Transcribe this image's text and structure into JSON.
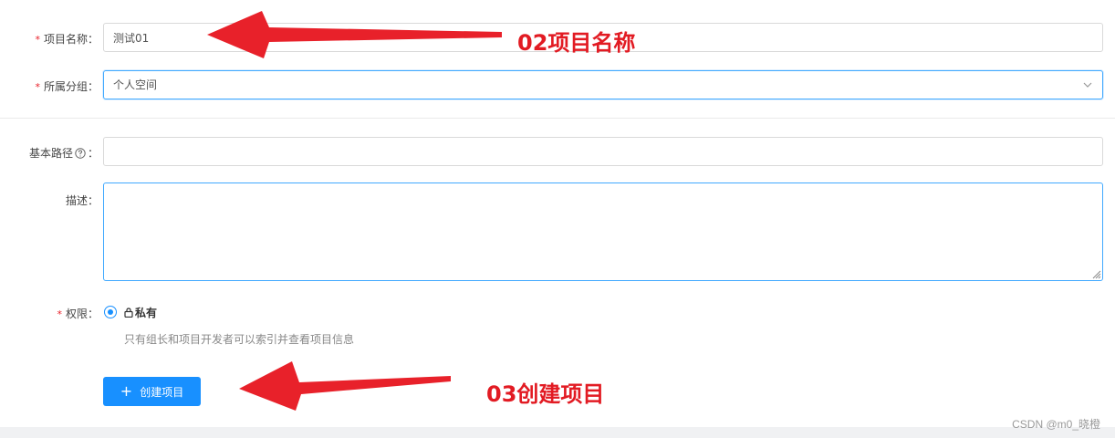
{
  "form": {
    "project_name": {
      "label": "项目名称",
      "value": "测试01"
    },
    "group": {
      "label": "所属分组",
      "value": "个人空间"
    },
    "base_path": {
      "label": "基本路径",
      "value": ""
    },
    "description": {
      "label": "描述",
      "value": ""
    },
    "permission": {
      "label": "权限",
      "option_label": "私有",
      "hint": "只有组长和项目开发者可以索引并查看项目信息"
    },
    "colon": "："
  },
  "actions": {
    "create_label": "创建项目",
    "create_icon": "plus-icon"
  },
  "annotations": {
    "project_name_note": "02项目名称",
    "create_note": "03创建项目"
  },
  "watermark": "CSDN @m0_晓橙",
  "colors": {
    "primary": "#1890ff",
    "required": "#e8212a",
    "annotation": "#e21b23"
  }
}
